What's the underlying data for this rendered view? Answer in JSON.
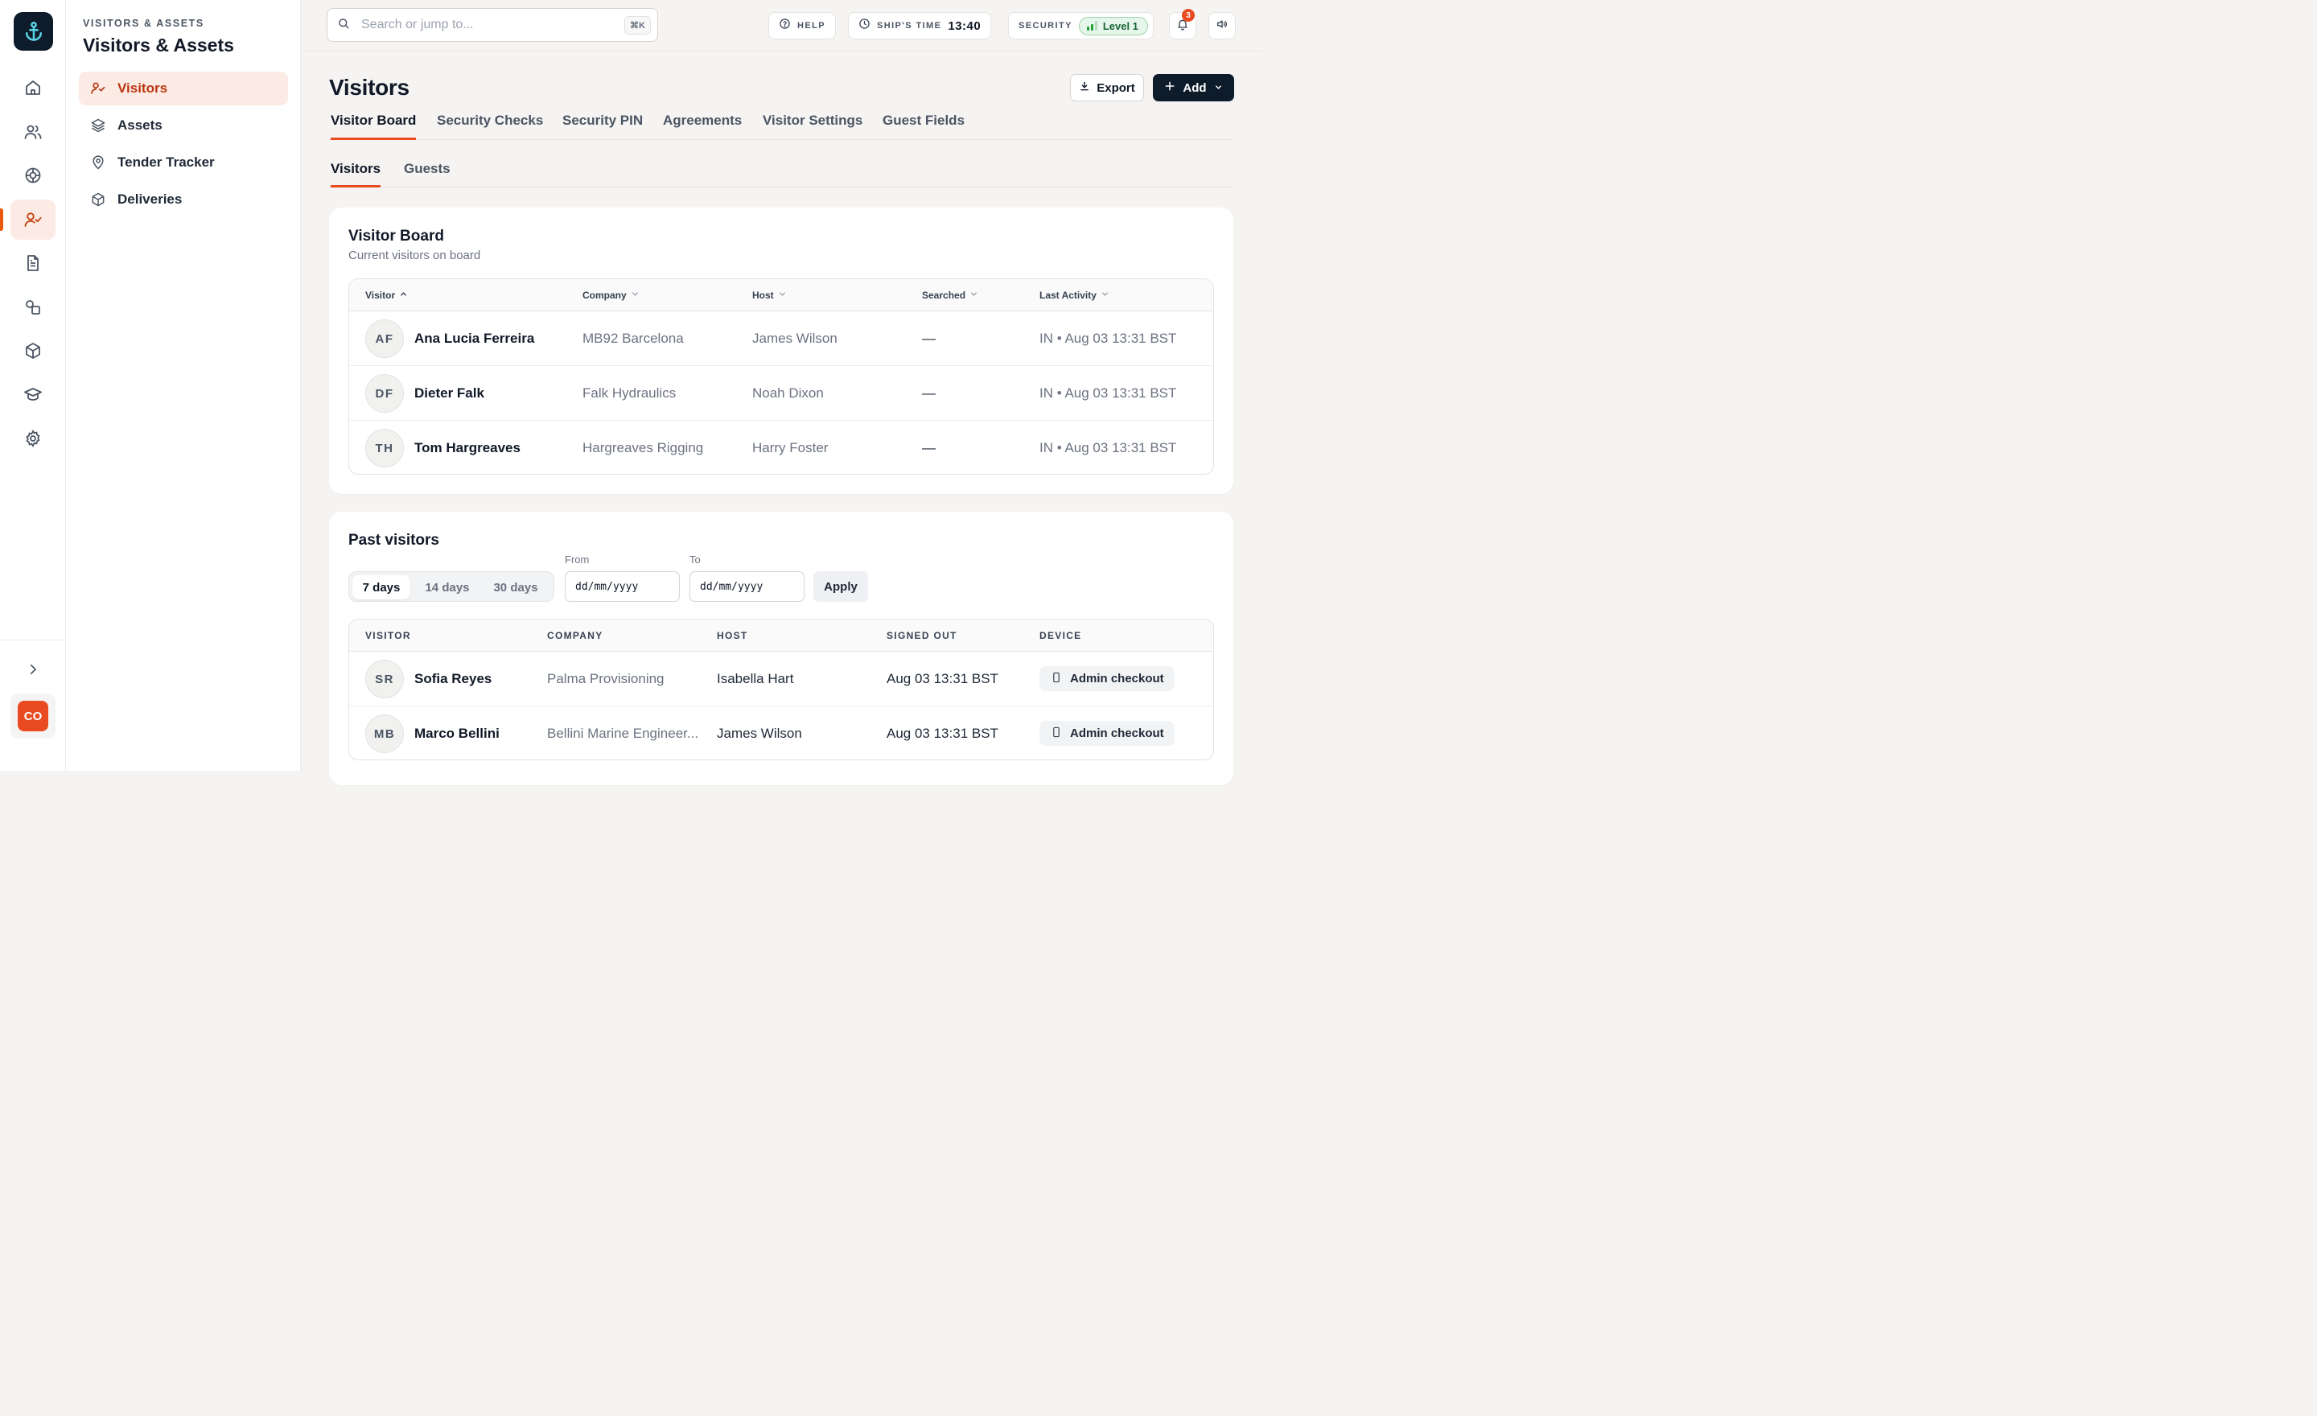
{
  "rail": {
    "user_initials": "CO",
    "items": [
      "home-icon",
      "people-icon",
      "lifebuoy-icon",
      "visitor-icon",
      "document-icon",
      "shapes-icon",
      "box-icon",
      "graduation-cap-icon",
      "gear-icon"
    ],
    "active": "visitor-icon"
  },
  "sidebar": {
    "eyebrow": "VISITORS & ASSETS",
    "title": "Visitors & Assets",
    "items": [
      {
        "label": "Visitors",
        "icon": "user-check-icon",
        "active": true
      },
      {
        "label": "Assets",
        "icon": "layers-icon",
        "active": false
      },
      {
        "label": "Tender Tracker",
        "icon": "map-pin-icon",
        "active": false
      },
      {
        "label": "Deliveries",
        "icon": "box-icon",
        "active": false
      }
    ]
  },
  "topbar": {
    "search_placeholder": "Search or jump to...",
    "search_shortcut": "⌘K",
    "help_label": "HELP",
    "ships_time_label": "SHIP'S TIME",
    "ships_time_value": "13:40",
    "security_label": "SECURITY",
    "security_level": "Level 1",
    "notification_count": "3"
  },
  "page": {
    "title": "Visitors",
    "export_label": "Export",
    "add_label": "Add",
    "tabs": [
      "Visitor Board",
      "Security Checks",
      "Security PIN",
      "Agreements",
      "Visitor Settings",
      "Guest Fields"
    ],
    "active_tab": "Visitor Board",
    "subtabs": [
      "Visitors",
      "Guests"
    ],
    "active_subtab": "Visitors"
  },
  "board": {
    "title": "Visitor Board",
    "subtitle": "Current visitors on board",
    "columns": [
      "Visitor",
      "Company",
      "Host",
      "Searched",
      "Last Activity"
    ],
    "rows": [
      {
        "initials": "AF",
        "name": "Ana Lucia Ferreira",
        "company": "MB92 Barcelona",
        "host": "James Wilson",
        "searched": "—",
        "activity": "IN • Aug 03 13:31 BST"
      },
      {
        "initials": "DF",
        "name": "Dieter Falk",
        "company": "Falk Hydraulics",
        "host": "Noah Dixon",
        "searched": "—",
        "activity": "IN • Aug 03 13:31 BST"
      },
      {
        "initials": "TH",
        "name": "Tom Hargreaves",
        "company": "Hargreaves Rigging",
        "host": "Harry Foster",
        "searched": "—",
        "activity": "IN • Aug 03 13:31 BST"
      }
    ]
  },
  "past": {
    "title": "Past visitors",
    "ranges": [
      "7 days",
      "14 days",
      "30 days"
    ],
    "active_range": "7 days",
    "from_label": "From",
    "to_label": "To",
    "date_placeholder": "dd/mm/yyyy",
    "apply_label": "Apply",
    "columns": [
      "VISITOR",
      "COMPANY",
      "HOST",
      "SIGNED OUT",
      "DEVICE"
    ],
    "rows": [
      {
        "initials": "SR",
        "name": "Sofia Reyes",
        "company": "Palma Provisioning",
        "host": "Isabella Hart",
        "signed_out": "Aug 03 13:31 BST",
        "device": "Admin checkout"
      },
      {
        "initials": "MB",
        "name": "Marco Bellini",
        "company": "Bellini Marine Engineer...",
        "host": "James Wilson",
        "signed_out": "Aug 03 13:31 BST",
        "device": "Admin checkout"
      }
    ]
  },
  "colors": {
    "accent": "#ea4a1f",
    "navy": "#0d1b2a",
    "active_bg": "#fcebe4",
    "security_green": "#22a33a"
  }
}
